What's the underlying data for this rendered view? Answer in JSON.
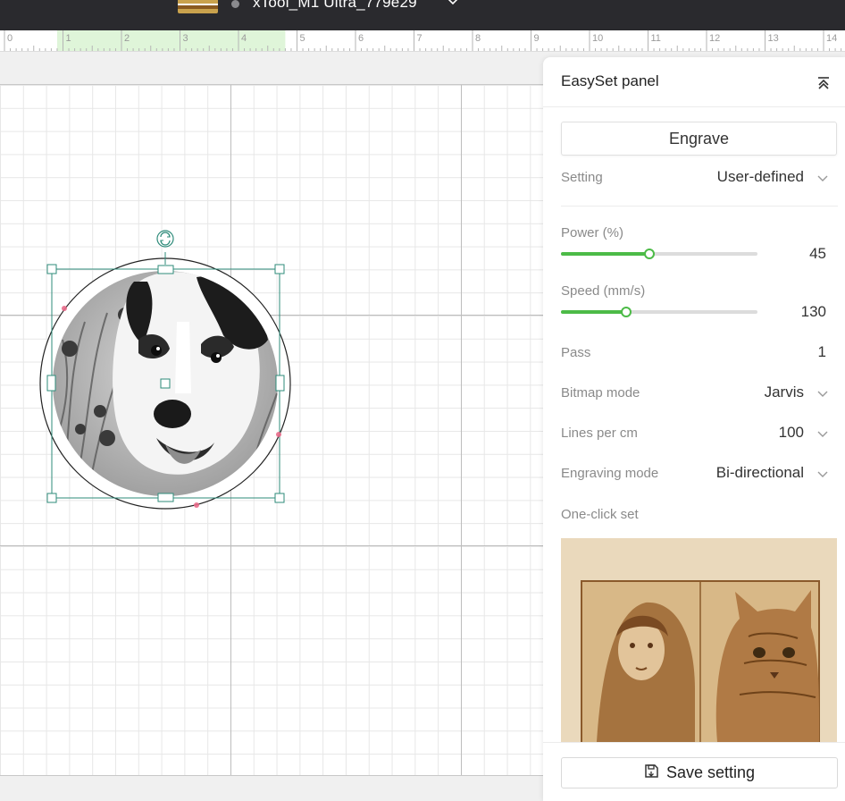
{
  "topbar": {
    "device_name": "xTool_M1 Ultra_779e29",
    "status_color": "#8a8a8e"
  },
  "ruler": {
    "ticks": [
      "0",
      "1",
      "2",
      "3",
      "4",
      "5",
      "6",
      "7",
      "8",
      "9",
      "10",
      "11",
      "12",
      "13",
      "14"
    ],
    "highlight_color": "#dff5d9"
  },
  "canvas": {
    "object": {
      "type": "engraving-image",
      "subject": "grayscale dog portrait in circle",
      "selection_color": "#2e8b7a"
    }
  },
  "panel": {
    "title": "EasySet panel",
    "mode_tab": "Engrave",
    "setting": {
      "label": "Setting",
      "value": "User-defined"
    },
    "power": {
      "label": "Power (%)",
      "value": "45",
      "level": 45
    },
    "speed": {
      "label": "Speed (mm/s)",
      "value": "130",
      "level": 33
    },
    "pass": {
      "label": "Pass",
      "value": "1"
    },
    "bitmap_mode": {
      "label": "Bitmap mode",
      "value": "Jarvis"
    },
    "lines_per_cm": {
      "label": "Lines per cm",
      "value": "100"
    },
    "engraving_mode": {
      "label": "Engraving mode",
      "value": "Bi-directional"
    },
    "one_click_set": {
      "label": "One-click set"
    },
    "save_button": {
      "label": "Save setting"
    },
    "accent_color": "#4cbb47"
  }
}
